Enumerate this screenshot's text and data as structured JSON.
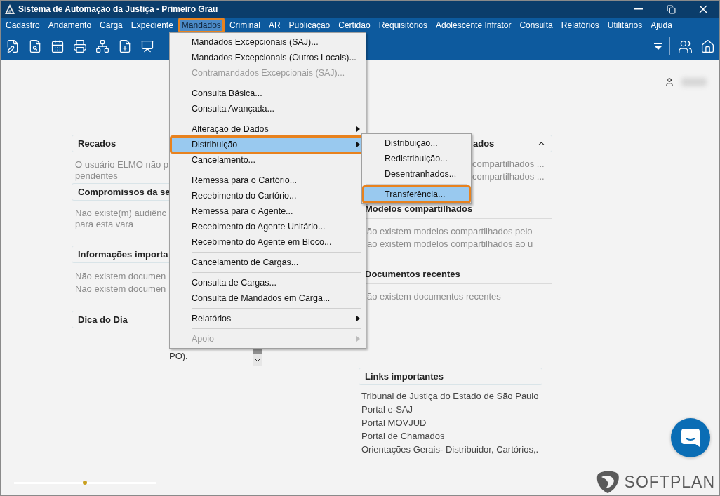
{
  "window": {
    "title": "Sistema de Automação da Justiça - Primeiro Grau"
  },
  "menu_bar": [
    {
      "label": "Cadastro",
      "selected": false,
      "highlighted": false
    },
    {
      "label": "Andamento",
      "selected": false,
      "highlighted": false
    },
    {
      "label": "Carga",
      "selected": false,
      "highlighted": false
    },
    {
      "label": "Expediente",
      "selected": false,
      "highlighted": false
    },
    {
      "label": "Mandados",
      "selected": true,
      "highlighted": true
    },
    {
      "label": "Criminal",
      "selected": false,
      "highlighted": false
    },
    {
      "label": "AR",
      "selected": false,
      "highlighted": false
    },
    {
      "label": "Publicação",
      "selected": false,
      "highlighted": false
    },
    {
      "label": "Certidão",
      "selected": false,
      "highlighted": false
    },
    {
      "label": "Requisitórios",
      "selected": false,
      "highlighted": false
    },
    {
      "label": "Adolescente Infrator",
      "selected": false,
      "highlighted": false
    },
    {
      "label": "Consulta",
      "selected": false,
      "highlighted": false
    },
    {
      "label": "Relatórios",
      "selected": false,
      "highlighted": false
    },
    {
      "label": "Utilitários",
      "selected": false,
      "highlighted": false
    },
    {
      "label": "Ajuda",
      "selected": false,
      "highlighted": false
    }
  ],
  "dropdown": {
    "items": [
      {
        "kind": "item",
        "label": "Mandados Excepcionais (SAJ)...",
        "disabled": false,
        "submenu": false,
        "selected": false,
        "highlighted": false
      },
      {
        "kind": "item",
        "label": "Mandados Excepcionais (Outros Locais)...",
        "disabled": false,
        "submenu": false,
        "selected": false,
        "highlighted": false
      },
      {
        "kind": "item",
        "label": "Contramandados Excepcionais (SAJ)...",
        "disabled": true,
        "submenu": false,
        "selected": false,
        "highlighted": false
      },
      {
        "kind": "separator"
      },
      {
        "kind": "item",
        "label": "Consulta Básica...",
        "disabled": false,
        "submenu": false,
        "selected": false,
        "highlighted": false
      },
      {
        "kind": "item",
        "label": "Consulta Avançada...",
        "disabled": false,
        "submenu": false,
        "selected": false,
        "highlighted": false
      },
      {
        "kind": "separator"
      },
      {
        "kind": "item",
        "label": "Alteração de Dados",
        "disabled": false,
        "submenu": true,
        "selected": false,
        "highlighted": false
      },
      {
        "kind": "item",
        "label": "Distribuição",
        "disabled": false,
        "submenu": true,
        "selected": true,
        "highlighted": true
      },
      {
        "kind": "item",
        "label": "Cancelamento...",
        "disabled": false,
        "submenu": false,
        "selected": false,
        "highlighted": false
      },
      {
        "kind": "separator"
      },
      {
        "kind": "item",
        "label": "Remessa para o Cartório...",
        "disabled": false,
        "submenu": false,
        "selected": false,
        "highlighted": false
      },
      {
        "kind": "item",
        "label": "Recebimento do Cartório...",
        "disabled": false,
        "submenu": false,
        "selected": false,
        "highlighted": false
      },
      {
        "kind": "item",
        "label": "Remessa para o Agente...",
        "disabled": false,
        "submenu": false,
        "selected": false,
        "highlighted": false
      },
      {
        "kind": "item",
        "label": "Recebimento do Agente Unitário...",
        "disabled": false,
        "submenu": false,
        "selected": false,
        "highlighted": false
      },
      {
        "kind": "item",
        "label": "Recebimento do Agente em Bloco...",
        "disabled": false,
        "submenu": false,
        "selected": false,
        "highlighted": false
      },
      {
        "kind": "separator"
      },
      {
        "kind": "item",
        "label": "Cancelamento de Cargas...",
        "disabled": false,
        "submenu": false,
        "selected": false,
        "highlighted": false
      },
      {
        "kind": "separator"
      },
      {
        "kind": "item",
        "label": "Consulta de Cargas...",
        "disabled": false,
        "submenu": false,
        "selected": false,
        "highlighted": false
      },
      {
        "kind": "item",
        "label": "Consulta de Mandados em Carga...",
        "disabled": false,
        "submenu": false,
        "selected": false,
        "highlighted": false
      },
      {
        "kind": "separator"
      },
      {
        "kind": "item",
        "label": "Relatórios",
        "disabled": false,
        "submenu": true,
        "selected": false,
        "highlighted": false
      },
      {
        "kind": "separator"
      },
      {
        "kind": "item",
        "label": "Apoio",
        "disabled": true,
        "submenu": true,
        "selected": false,
        "highlighted": false
      }
    ]
  },
  "submenu": {
    "items": [
      {
        "kind": "item",
        "label": "Distribuição...",
        "selected": false,
        "highlighted": false
      },
      {
        "kind": "item",
        "label": "Redistribuição...",
        "selected": false,
        "highlighted": false
      },
      {
        "kind": "item",
        "label": "Desentranhados...",
        "selected": false,
        "highlighted": false
      },
      {
        "kind": "separator"
      },
      {
        "kind": "item",
        "label": "Transferência...",
        "selected": true,
        "highlighted": true
      }
    ]
  },
  "left_panels": [
    {
      "title": "Recados",
      "lines": [
        "O usuário ELMO não p",
        "pendentes"
      ]
    },
    {
      "title": "Compromissos da se",
      "lines": [
        "Não existe(m) audiênc",
        "para esta vara"
      ]
    },
    {
      "title": "Informações importa",
      "lines": [
        "Não existem documen",
        "Não existem documen"
      ]
    },
    {
      "title": "Dica do Dia"
    }
  ],
  "tip_text": "PO).",
  "right_panels": [
    {
      "kind": "clipped",
      "title": "ados",
      "expanded": true,
      "lines": [
        "compartilhados ...",
        "compartilhados ..."
      ]
    },
    {
      "kind": "ruled",
      "title": "Modelos compartilhados",
      "lines": [
        "ão existem modelos compartilhados pelo",
        "ão existem modelos compartilhados ao u"
      ]
    },
    {
      "kind": "ruled",
      "title": "Documentos recentes",
      "lines": [
        "ão existem documentos recentes"
      ]
    },
    {
      "kind": "links",
      "title": "Links importantes",
      "lines": [
        "Tribunal de Justiça do Estado de São Paulo",
        "Portal e-SAJ",
        "Portal MOVJUD",
        "Portal de Chamados",
        "Orientações Gerais- Distribuidor, Cartórios,."
      ]
    }
  ],
  "logo": {
    "text": "SOFTPLAN"
  }
}
